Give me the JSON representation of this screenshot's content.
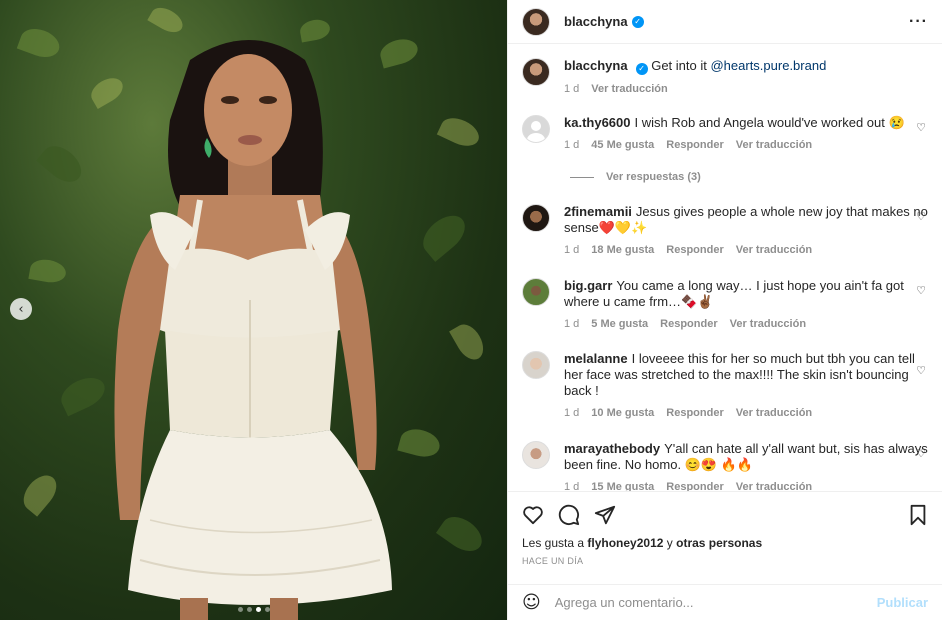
{
  "post": {
    "username": "blacchyna",
    "caption_text": "Get into it",
    "caption_mention": "@hearts.pure.brand",
    "caption_time": "1 d",
    "caption_translate": "Ver traducción"
  },
  "comments": [
    {
      "user": "ka.thy6600",
      "text": "I wish Rob and Angela would've worked out 😢",
      "time": "1 d",
      "likes": "45 Me gusta",
      "reply": "Responder",
      "translate": "Ver traducción"
    },
    {
      "user": "2finemamii",
      "text": "Jesus gives people a whole new joy that makes no sense❤️💛✨",
      "time": "1 d",
      "likes": "18 Me gusta",
      "reply": "Responder",
      "translate": "Ver traducción"
    },
    {
      "user": "big.garr",
      "text": "You came a long way… I just hope you ain't fa got where u came frm…🍫✌🏾",
      "time": "1 d",
      "likes": "5 Me gusta",
      "reply": "Responder",
      "translate": "Ver traducción"
    },
    {
      "user": "melalanne",
      "text": "I loveeee this for her so much but tbh you can tell her face was stretched to the max!!!! The skin isn't bouncing back !",
      "time": "1 d",
      "likes": "10 Me gusta",
      "reply": "Responder",
      "translate": "Ver traducción"
    },
    {
      "user": "marayathebody",
      "text": "Y'all can hate all y'all want but, sis has always been fine. No homo. 😊😍 🔥🔥",
      "time": "1 d",
      "likes": "15 Me gusta",
      "reply": "Responder",
      "translate": "Ver traducción"
    }
  ],
  "view_replies": "Ver respuestas (3)",
  "likes_line": {
    "prefix": "Les gusta a",
    "user": "flyhoney2012",
    "middle": "y",
    "others": "otras personas"
  },
  "time_ago": "HACE UN DÍA",
  "add_comment": {
    "placeholder": "Agrega un comentario...",
    "publish": "Publicar"
  },
  "icons": [
    "heart-icon",
    "comment-icon",
    "share-icon",
    "save-icon",
    "emoji-icon",
    "more-icon",
    "verified-icon",
    "chevron-left-icon"
  ],
  "colors": {
    "verified": "#0095f6",
    "link": "#00376b",
    "muted": "#8e8e8e",
    "publish_disabled": "#b2dffc"
  },
  "carousel": {
    "slides": 4,
    "active": 3
  }
}
